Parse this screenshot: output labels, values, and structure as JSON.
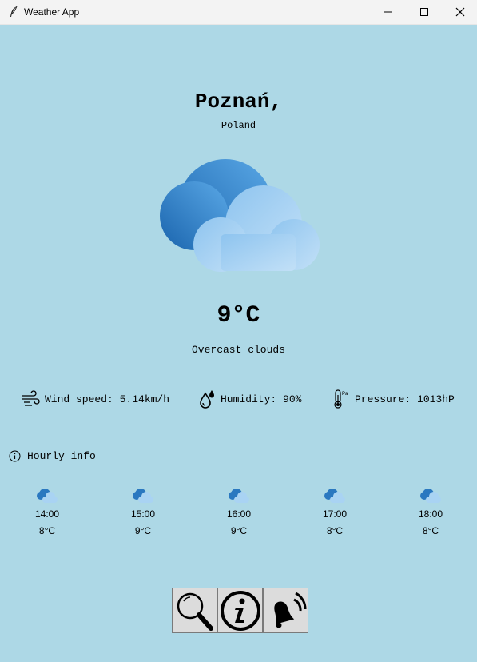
{
  "window": {
    "title": "Weather App"
  },
  "location": {
    "city": "Poznań,",
    "country": "Poland"
  },
  "current": {
    "icon": "cloud-icon",
    "temperature": "9°C",
    "description": "Overcast clouds"
  },
  "stats": {
    "wind": "Wind speed: 5.14km/h",
    "humidity": "Humidity: 90%",
    "pressure": "Pressure: 1013hP"
  },
  "hourly": {
    "header": "Hourly info",
    "items": [
      {
        "time": "14:00",
        "temp": "8°C"
      },
      {
        "time": "15:00",
        "temp": "9°C"
      },
      {
        "time": "16:00",
        "temp": "9°C"
      },
      {
        "time": "17:00",
        "temp": "8°C"
      },
      {
        "time": "18:00",
        "temp": "8°C"
      }
    ]
  },
  "toolbar": {
    "buttons": [
      "search-icon",
      "info-icon",
      "alarm-bell-icon"
    ]
  },
  "colors": {
    "background": "#add8e6",
    "cloud_dark": "#1e6fb5",
    "cloud_light": "#b8dcf5"
  }
}
